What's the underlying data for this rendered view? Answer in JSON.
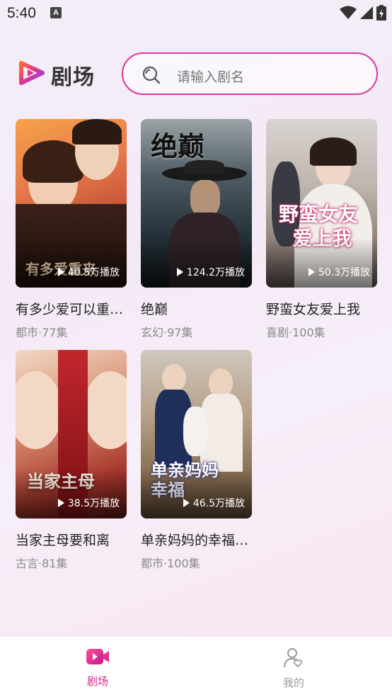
{
  "status": {
    "time": "5:40"
  },
  "header": {
    "brand": "剧场",
    "search_placeholder": "请输入剧名"
  },
  "dramas": [
    {
      "title": "有多少爱可以重来",
      "display_title": "有多少爱可以重…",
      "genre_episodes": "都市·77集",
      "plays": "40.5万播放"
    },
    {
      "title": "绝巅",
      "display_title": "绝巅",
      "genre_episodes": "玄幻·97集",
      "plays": "124.2万播放"
    },
    {
      "title": "野蛮女友爱上我",
      "display_title": "野蛮女友爱上我",
      "genre_episodes": "喜剧·100集",
      "plays": "50.3万播放"
    },
    {
      "title": "当家主母要和离",
      "display_title": "当家主母要和离",
      "genre_episodes": "古言·81集",
      "plays": "38.5万播放"
    },
    {
      "title": "单亲妈妈的幸福",
      "display_title": "单亲妈妈的幸福…",
      "genre_episodes": "都市·100集",
      "plays": "46.5万播放"
    }
  ],
  "tabbar": {
    "tabs": [
      {
        "label": "剧场",
        "active": true
      },
      {
        "label": "我的",
        "active": false
      }
    ]
  },
  "colors": {
    "accent": "#d9389c",
    "active_tab": "#d12a8a",
    "inactive_tab": "#999999"
  }
}
